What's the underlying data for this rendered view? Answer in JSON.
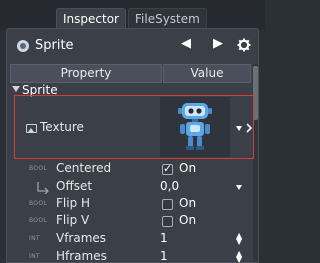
{
  "tabs": [
    {
      "label": "Inspector",
      "active": true
    },
    {
      "label": "FileSystem",
      "active": false
    }
  ],
  "object": {
    "title": "Sprite",
    "icon": "node-icon",
    "back": "◀",
    "forward": "▶",
    "settings_icon": "gear-icon"
  },
  "table": {
    "col_property": "Property",
    "col_value": "Value"
  },
  "section": {
    "label": "Sprite"
  },
  "texture": {
    "label": "Texture",
    "icon": "image-icon"
  },
  "properties": [
    {
      "kind": "BOOL",
      "label": "Centered",
      "value": "On",
      "checked": true
    },
    {
      "kind": "",
      "label": "Offset",
      "value": "0,0"
    },
    {
      "kind": "BOOL",
      "label": "Flip H",
      "value": "On",
      "checked": false
    },
    {
      "kind": "BOOL",
      "label": "Flip V",
      "value": "On",
      "checked": false
    },
    {
      "kind": "INT",
      "label": "Vframes",
      "value": "1"
    },
    {
      "kind": "INT",
      "label": "Hframes",
      "value": "1"
    }
  ],
  "colors": {
    "background": "#2b2f36",
    "panel": "#3a3f48",
    "highlight_border": "#d73a3a",
    "robot_blue": "#5aa8e6"
  }
}
